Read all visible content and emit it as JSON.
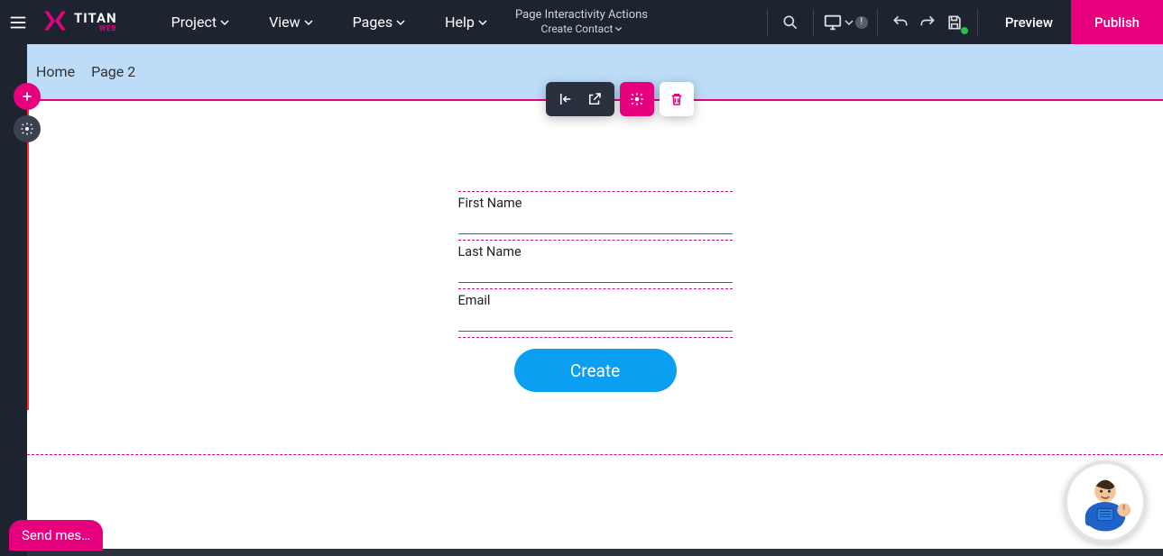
{
  "topbar": {
    "logo": {
      "brand": "TITAN",
      "sub": "WEB"
    },
    "menus": {
      "project": "Project",
      "view": "View",
      "pages": "Pages",
      "help": "Help"
    },
    "center": {
      "title": "Page Interactivity Actions",
      "subtitle": "Create Contact"
    },
    "device_badge": "!",
    "preview": "Preview",
    "publish": "Publish"
  },
  "page_header": {
    "crumb1": "Home",
    "crumb2": "Page 2"
  },
  "form": {
    "first_name_label": "First Name",
    "last_name_label": "Last Name",
    "email_label": "Email",
    "submit_label": "Create"
  },
  "chat": {
    "send": "Send mes…"
  }
}
